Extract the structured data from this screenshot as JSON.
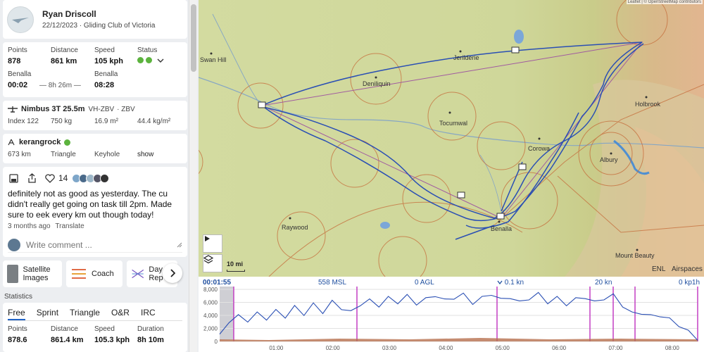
{
  "pilot": {
    "name": "Ryan Driscoll",
    "date_club": "22/12/2023 · Gliding Club of Victoria"
  },
  "stats": {
    "points_label": "Points",
    "points": "878",
    "distance_label": "Distance",
    "distance": "861 km",
    "speed_label": "Speed",
    "speed": "105 kph",
    "status_label": "Status",
    "takeoff_place": "Benalla",
    "takeoff_time": "00:02",
    "landing_place": "Benalla",
    "landing_time": "08:28",
    "duration": "— 8h 26m —"
  },
  "glider": {
    "model": "Nimbus 3T 25.5m",
    "rego": "VH-ZBV",
    "comp": "· ZBV",
    "index": "Index 122",
    "mass": "750 kg",
    "area": "16.9 m²",
    "loading": "44.4 kg/m²"
  },
  "task": {
    "name": "kerangrock",
    "distance": "673 km",
    "type": "Triangle",
    "sector": "Keyhole",
    "action": "show"
  },
  "comment": {
    "likes": "14",
    "text": "definitely not as good as yesterday. The cu didn't really get going on task till 2pm. Made sure to eek every km out though today!",
    "time": "3 months ago",
    "translate": "Translate",
    "placeholder": "Write comment ..."
  },
  "tools": {
    "satellite": "Satellite Images",
    "coach": "Coach",
    "day": "Day Rep"
  },
  "statistics": {
    "title": "Statistics",
    "tabs": [
      "Free",
      "Sprint",
      "Triangle",
      "O&R",
      "IRC"
    ],
    "points_label": "Points",
    "points": "878.6",
    "distance_label": "Distance",
    "distance": "861.4 km",
    "speed_label": "Speed",
    "speed": "105.3 kph",
    "duration_label": "Duration",
    "duration": "8h 10m"
  },
  "map": {
    "places": [
      "Swan Hill",
      "Deniliquin",
      "Jerilderie",
      "Tocumwal",
      "Corowa",
      "Holbrook",
      "Albury",
      "Raywood",
      "Benalla",
      "Mount Beauty"
    ],
    "scale": "10 mi",
    "attribution": "Leaflet | © OpenStreetMap contributors",
    "enl": "ENL",
    "airspaces": "Airspaces"
  },
  "barogram": {
    "time": "00:01:55",
    "altitude": "558 MSL",
    "agl": "0 AGL",
    "vario": "0.1 kn",
    "wind": "20 kn",
    "ground_speed": "0 kp1h",
    "y_ticks": [
      "8,000",
      "6,000",
      "4,000",
      "2,000",
      "0"
    ],
    "x_ticks": [
      "01:00",
      "02:00",
      "03:00",
      "04:00",
      "05:00",
      "06:00",
      "07:00",
      "08:00"
    ],
    "altitude_profile": [
      800,
      3200,
      3800,
      3300,
      4200,
      3600,
      4600,
      3900,
      5200,
      4300,
      5600,
      4600,
      6000,
      5200,
      4400,
      5800,
      6200,
      5600,
      6600,
      6100,
      6900,
      5900,
      6400,
      7200,
      6200,
      6800,
      7100,
      6000,
      6600,
      7400,
      6300,
      6900,
      5900,
      6700,
      7200,
      6100,
      6600,
      5800,
      6400,
      6900,
      5900,
      6700,
      7000,
      5600,
      4200,
      4500,
      3800,
      4100,
      3300,
      2600,
      1400,
      500
    ]
  },
  "colors": {
    "accent": "#1f62c6",
    "track": "#2a4fb4",
    "airspace": "#c56c3a",
    "ok": "#5cb33e"
  }
}
